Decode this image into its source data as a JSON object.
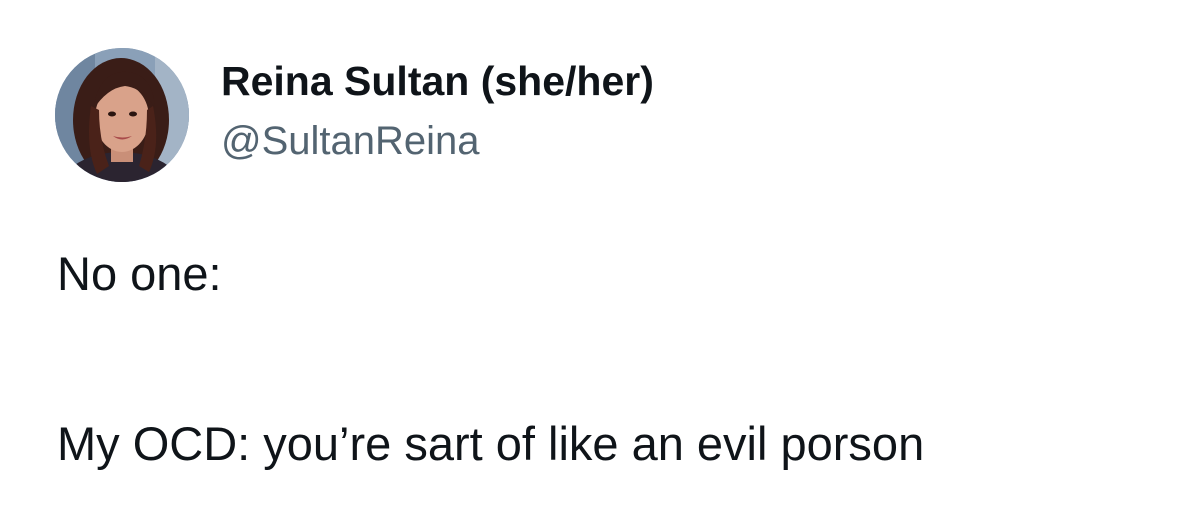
{
  "author": {
    "display_name": "Reina Sultan (she/her)",
    "handle": "@SultanReina",
    "avatar_icon": "profile-photo-avatar"
  },
  "tweet": {
    "lines": [
      "No one:",
      "My OCD: you’re sart of like an evil porson"
    ]
  },
  "colors": {
    "text_primary": "#0f1419",
    "text_secondary": "#536471",
    "background": "#ffffff"
  }
}
